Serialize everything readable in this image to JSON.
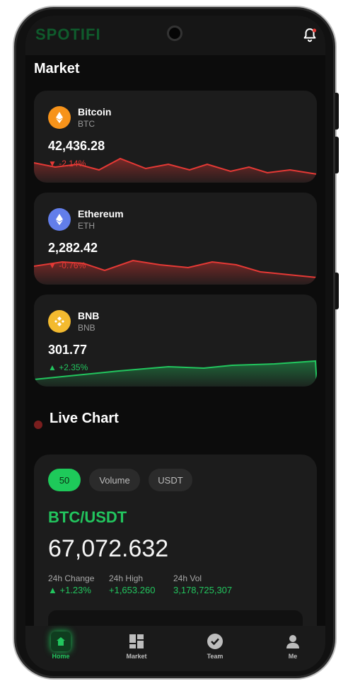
{
  "app": {
    "brand": "SPOTIFI"
  },
  "market": {
    "title": "Market",
    "coins": [
      {
        "name": "Bitcoin",
        "symbol": "BTC",
        "price": "42,436.28",
        "change": "▼ -2.14%",
        "trend": "down",
        "icon": "bitcoin-icon",
        "icon_color": "#f7931a"
      },
      {
        "name": "Ethereum",
        "symbol": "ETH",
        "price": "2,282.42",
        "change": "▼ -0.76%",
        "trend": "down",
        "icon": "ethereum-icon",
        "icon_color": "#627eea"
      },
      {
        "name": "BNB",
        "symbol": "BNB",
        "price": "301.77",
        "change": "▲ +2.35%",
        "trend": "up",
        "icon": "bnb-icon",
        "icon_color": "#f3ba2f"
      }
    ]
  },
  "live_chart": {
    "title": "Live Chart",
    "tabs": [
      "50",
      "Volume",
      "USDT"
    ],
    "active_tab": "50",
    "pair": "BTC/USDT",
    "price": "67,072.632",
    "stats": [
      {
        "label": "24h Change",
        "value": "▲ +1.23%"
      },
      {
        "label": "24h High",
        "value": "+1,653.260"
      },
      {
        "label": "24h Vol",
        "value": "3,178,725,307"
      }
    ]
  },
  "nav": {
    "items": [
      {
        "label": "Home",
        "icon": "home-icon",
        "active": true
      },
      {
        "label": "Market",
        "icon": "market-grid-icon",
        "active": false
      },
      {
        "label": "Team",
        "icon": "team-check-icon",
        "active": false
      },
      {
        "label": "Me",
        "icon": "user-icon",
        "active": false
      }
    ]
  },
  "colors": {
    "accent": "#22c55e",
    "down": "#e53935",
    "up": "#22c55e"
  }
}
